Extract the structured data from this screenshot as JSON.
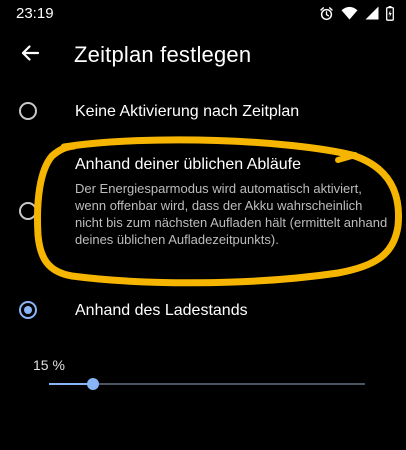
{
  "status_bar": {
    "time": "23:19",
    "icons": [
      "alarm-icon",
      "wifi-icon",
      "signal-icon",
      "battery-icon"
    ]
  },
  "header": {
    "title": "Zeitplan festlegen",
    "back_icon": "arrow-back-icon"
  },
  "options": [
    {
      "label": "Keine Aktivierung nach Zeitplan",
      "description": "",
      "selected": false
    },
    {
      "label": "Anhand deiner üblichen Abläufe",
      "description": "Der Energiesparmodus wird automatisch aktiviert, wenn offenbar wird, dass der Akku wahrscheinlich nicht bis zum nächsten Aufladen hält (ermittelt anhand deines üblichen Aufladezeitpunkts).",
      "selected": false
    },
    {
      "label": "Anhand des Ladestands",
      "description": "",
      "selected": true
    }
  ],
  "battery_level": {
    "label": "15 %",
    "value": 15,
    "fill_fraction": 0.14
  },
  "colors": {
    "background": "#000000",
    "accent": "#8ab4f8",
    "annotation": "#f5b500"
  }
}
